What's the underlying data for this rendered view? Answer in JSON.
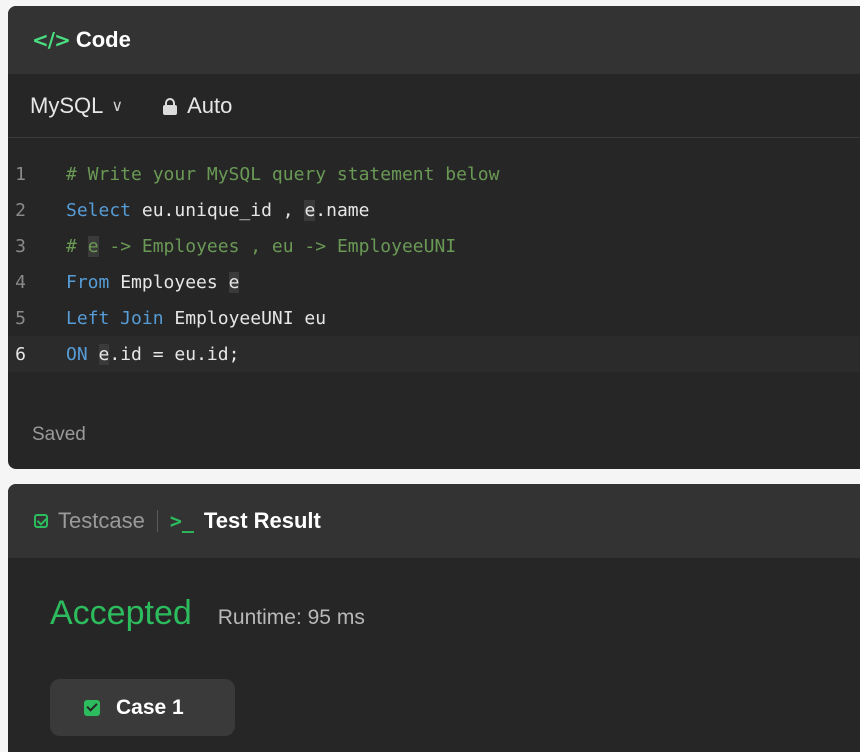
{
  "code_panel": {
    "icon": "code-brackets-icon",
    "icon_glyph": "</>",
    "title": "Code",
    "language": "MySQL",
    "mode": "Auto",
    "status": "Saved",
    "lines": [
      {
        "num": "1",
        "text": "# Write your MySQL query statement below"
      },
      {
        "num": "2",
        "text": "Select eu.unique_id , e.name"
      },
      {
        "num": "3",
        "text": "# e -> Employees , eu -> EmployeeUNI"
      },
      {
        "num": "4",
        "text": "From Employees e"
      },
      {
        "num": "5",
        "text": "Left Join EmployeeUNI eu"
      },
      {
        "num": "6",
        "text": "ON e.id = eu.id;"
      }
    ]
  },
  "result_panel": {
    "tab_testcase": "Testcase",
    "tab_result": "Test Result",
    "term_glyph": ">_",
    "verdict": "Accepted",
    "runtime": "Runtime: 95 ms",
    "case_label": "Case 1"
  },
  "colors": {
    "accent_green": "#2cbb5d",
    "keyword": "#569cd6",
    "comment": "#6a9955",
    "panel_bg": "#262626"
  }
}
